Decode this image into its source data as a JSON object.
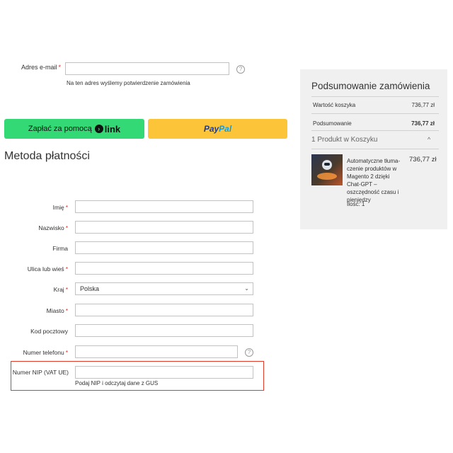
{
  "email": {
    "label": "Adres e-mail",
    "required_marker": "*",
    "value": "",
    "help": "?",
    "note": "Na ten adres wyślemy potwierdzenie zamówienia"
  },
  "payment_buttons": {
    "link_prefix": "Zapłać za pomocą",
    "link_brand": "link",
    "link_arrow": "›",
    "paypal_part1": "Pay",
    "paypal_part2": "Pal"
  },
  "section_title": "Metoda płatności",
  "fields": {
    "first_name": {
      "label": "Imię",
      "required": "*",
      "value": ""
    },
    "last_name": {
      "label": "Nazwisko",
      "required": "*",
      "value": ""
    },
    "company": {
      "label": "Firma",
      "value": ""
    },
    "street": {
      "label": "Ulica lub wieś",
      "required": "*",
      "value": ""
    },
    "country": {
      "label": "Kraj",
      "required": "*",
      "value": "Polska",
      "chevron": "⌄"
    },
    "city": {
      "label": "Miasto",
      "required": "*",
      "value": ""
    },
    "postcode": {
      "label": "Kod pocztowy",
      "value": ""
    },
    "phone": {
      "label": "Numer telefonu",
      "required": "*",
      "value": "",
      "help": "?"
    },
    "nip": {
      "label": "Numer NIP (VAT UE)",
      "value": "",
      "note": "Podaj NIP i odczytaj dane z GUS"
    }
  },
  "summary": {
    "title": "Podsumowanie zamówienia",
    "cart_value_label": "Wartość koszyka",
    "cart_value": "736,77 zł",
    "total_label": "Podsumowanie",
    "total_value": "736,77 zł",
    "cart_count": "1 Produkt w Koszyku",
    "toggle": "^",
    "product": {
      "name": "Automatyczne tłuma-czenie produktów w Magento 2 dzięki Chat-GPT – oszczędność czasu i pieniędzy",
      "price": "736,77 zł",
      "qty_label": "Ilość: 1"
    }
  },
  "colors": {
    "link_button": "#33d975",
    "paypal_button": "#fcc439",
    "highlight": "#e23b2a",
    "required": "#e02b27"
  }
}
